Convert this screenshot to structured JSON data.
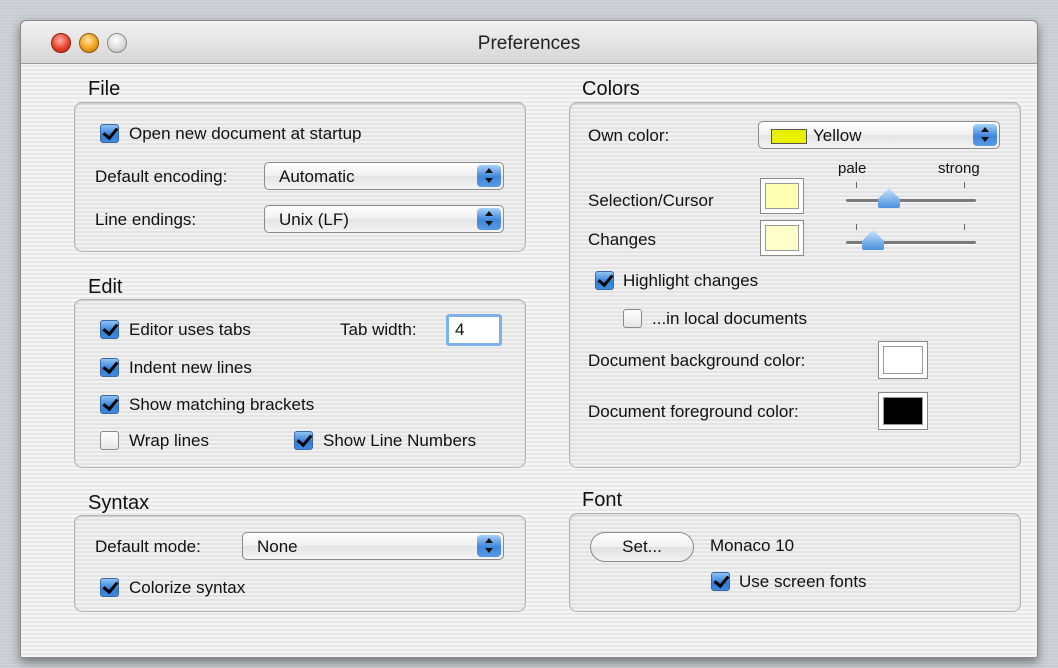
{
  "window": {
    "title": "Preferences"
  },
  "file": {
    "title": "File",
    "open_new_document": {
      "label": "Open new document at startup",
      "checked": true
    },
    "default_encoding": {
      "label": "Default encoding:",
      "value": "Automatic"
    },
    "line_endings": {
      "label": "Line endings:",
      "value": "Unix (LF)"
    }
  },
  "edit": {
    "title": "Edit",
    "editor_uses_tabs": {
      "label": "Editor uses tabs",
      "checked": true
    },
    "tab_width": {
      "label": "Tab width:",
      "value": "4"
    },
    "indent_new_lines": {
      "label": "Indent new lines",
      "checked": true
    },
    "show_matching_brackets": {
      "label": "Show matching brackets",
      "checked": true
    },
    "wrap_lines": {
      "label": "Wrap lines",
      "checked": false
    },
    "show_line_numbers": {
      "label": "Show Line Numbers",
      "checked": true
    }
  },
  "syntax": {
    "title": "Syntax",
    "default_mode": {
      "label": "Default mode:",
      "value": "None"
    },
    "colorize_syntax": {
      "label": "Colorize syntax",
      "checked": true
    }
  },
  "colors": {
    "title": "Colors",
    "own_color": {
      "label": "Own color:",
      "value": "Yellow",
      "swatch_color": "#e8f000"
    },
    "pale_label": "pale",
    "strong_label": "strong",
    "selection_cursor": {
      "label": "Selection/Cursor",
      "color": "#ffffb3",
      "intensity": 0.3
    },
    "changes": {
      "label": "Changes",
      "color": "#ffffcc",
      "intensity": 0.15
    },
    "highlight_changes": {
      "label": "Highlight changes",
      "checked": true
    },
    "in_local_documents": {
      "label": "...in local documents",
      "checked": false
    },
    "document_background": {
      "label": "Document background color:",
      "color": "#ffffff"
    },
    "document_foreground": {
      "label": "Document foreground color:",
      "color": "#000000"
    }
  },
  "font": {
    "title": "Font",
    "set_button": "Set...",
    "current_font": "Monaco 10",
    "use_screen_fonts": {
      "label": "Use screen fonts",
      "checked": true
    }
  }
}
